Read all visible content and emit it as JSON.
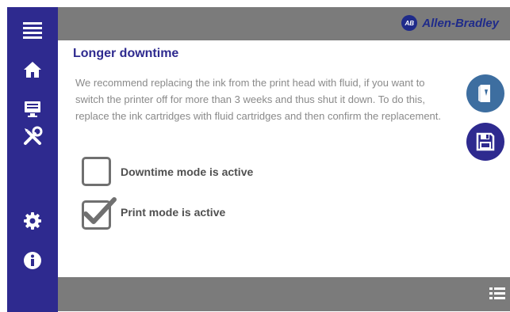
{
  "brand": {
    "logo_text": "AB",
    "name": "Allen-Bradley"
  },
  "sidebar": {
    "items": [
      {
        "icon": "menu-icon"
      },
      {
        "icon": "home-icon"
      },
      {
        "icon": "monitor-icon"
      },
      {
        "icon": "tools-icon"
      },
      {
        "icon": "gear-icon"
      },
      {
        "icon": "info-icon"
      }
    ]
  },
  "content": {
    "title": "Longer downtime",
    "description": "We recommend replacing the ink from the print head with fluid, if you want to switch the printer off for more than 3 weeks and thus shut it down. To do this, replace the ink cartridges with fluid cartridges and then confirm the replacement.",
    "options": [
      {
        "label": "Downtime mode is active",
        "checked": false
      },
      {
        "label": "Print mode is active",
        "checked": true
      }
    ]
  },
  "actions": {
    "fluid_button_icon": "fluid-cartridge-icon",
    "save_button_icon": "save-icon"
  },
  "footer": {
    "button_icon": "list-icon"
  },
  "colors": {
    "sidebar": "#2e2a8f",
    "bars": "#7b7b7b",
    "title": "#2e2a8f",
    "fluid_button": "#3d6ea0",
    "save_button": "#2e2a8f"
  }
}
